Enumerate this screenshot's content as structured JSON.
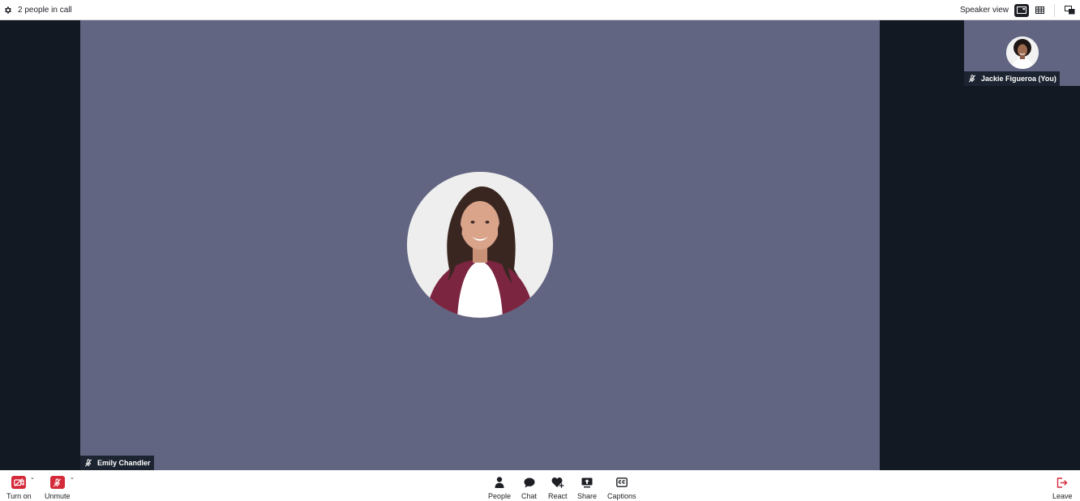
{
  "topbar": {
    "settings_icon": "gear-icon",
    "people_count_text": "2 people in call",
    "view_label": "Speaker view",
    "speaker_view_icon": "speaker-layout-icon",
    "grid_view_icon": "grid-layout-icon",
    "popout_icon": "picture-in-picture-icon"
  },
  "main_speaker": {
    "name": "Emily Chandler",
    "muted": true,
    "mic_icon": "mic-muted-icon"
  },
  "self_view": {
    "name": "Jackie Figueroa (You)",
    "muted": true,
    "mic_icon": "mic-muted-icon"
  },
  "controls": {
    "left": [
      {
        "label": "Turn on",
        "icon": "camera-off-icon"
      },
      {
        "label": "Unmute",
        "icon": "mic-off-icon"
      }
    ],
    "center": [
      {
        "label": "People",
        "icon": "person-icon"
      },
      {
        "label": "Chat",
        "icon": "chat-bubble-icon"
      },
      {
        "label": "React",
        "icon": "heart-plus-icon"
      },
      {
        "label": "Share",
        "icon": "screen-share-icon"
      },
      {
        "label": "Captions",
        "icon": "cc-icon"
      }
    ],
    "right": [
      {
        "label": "Leave",
        "icon": "leave-icon"
      }
    ]
  },
  "colors": {
    "stage_bg": "#121923",
    "tile_bg": "#616582",
    "danger": "#d42a3a",
    "text": "#1d1f24"
  }
}
